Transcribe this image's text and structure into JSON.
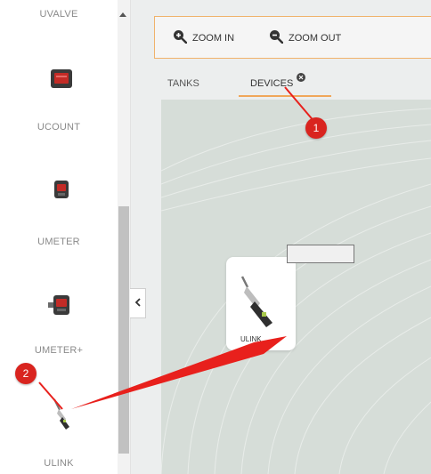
{
  "sidebar": {
    "items": [
      {
        "label": "UVALVE",
        "icon": "uvalve-device-icon"
      },
      {
        "label": "UCOUNT",
        "icon": "ucount-device-icon"
      },
      {
        "label": "UMETER",
        "icon": "umeter-device-icon"
      },
      {
        "label": "UMETER+",
        "icon": "umeter-plus-device-icon"
      },
      {
        "label": "ULINK",
        "icon": "ulink-nozzle-icon"
      }
    ]
  },
  "toolbar": {
    "zoom_in_label": "ZOOM IN",
    "zoom_out_label": "ZOOM OUT"
  },
  "tabs": [
    {
      "label": "TANKS",
      "active": false
    },
    {
      "label": "DEVICES",
      "active": true
    }
  ],
  "canvas": {
    "card_label": "ULINK"
  },
  "annotations": {
    "step1": "1",
    "step2": "2"
  },
  "colors": {
    "accent": "#f0a75a",
    "badge": "#d9241f",
    "arrow": "#e8201c"
  }
}
